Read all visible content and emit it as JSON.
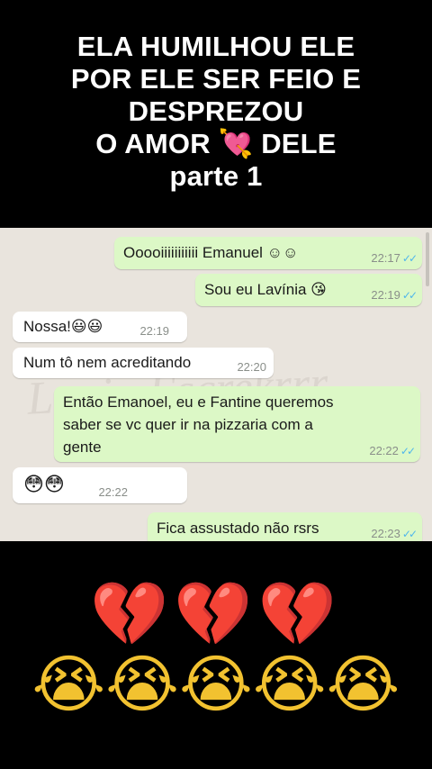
{
  "title": {
    "line1": "ELA HUMILHOU ELE",
    "line2": "POR ELE SER FEIO E",
    "line3": "DESPREZOU",
    "line4": "O AMOR 💘 DELE",
    "line5": "parte 1"
  },
  "chat": {
    "watermark": "Lagia Escrekrrr",
    "messages": [
      {
        "direction": "out",
        "text": "Ooooiiiiiiiiiii Emanuel ☺☺",
        "time": "22:17",
        "ticks": "✓✓"
      },
      {
        "direction": "out",
        "text": "Sou eu Lavínia 😘",
        "time": "22:19",
        "ticks": "✓✓"
      },
      {
        "direction": "in",
        "text": "Nossa!😃😃",
        "time": "22:19"
      },
      {
        "direction": "in",
        "text": "Num tô nem acreditando",
        "time": "22:20"
      },
      {
        "direction": "out",
        "line1": "Então Emanoel,  eu e Fantine queremos",
        "line2": "saber se vc quer ir na pizzaria com a",
        "line3": "gente",
        "time": "22:22",
        "ticks": "✓✓"
      },
      {
        "direction": "in",
        "text": "😳😳",
        "time": "22:22"
      },
      {
        "direction": "out",
        "text": "Fica assustado não rsrs",
        "time": "22:23",
        "ticks": "✓✓"
      }
    ]
  },
  "reactions": {
    "hearts": "💔💔💔",
    "crying": "😭😭😭😭😭"
  },
  "colors": {
    "outgoing_bubble": "#dcf8c6",
    "incoming_bubble": "#ffffff",
    "chat_background": "#e9e4dd",
    "read_ticks": "#4fb6ec"
  }
}
